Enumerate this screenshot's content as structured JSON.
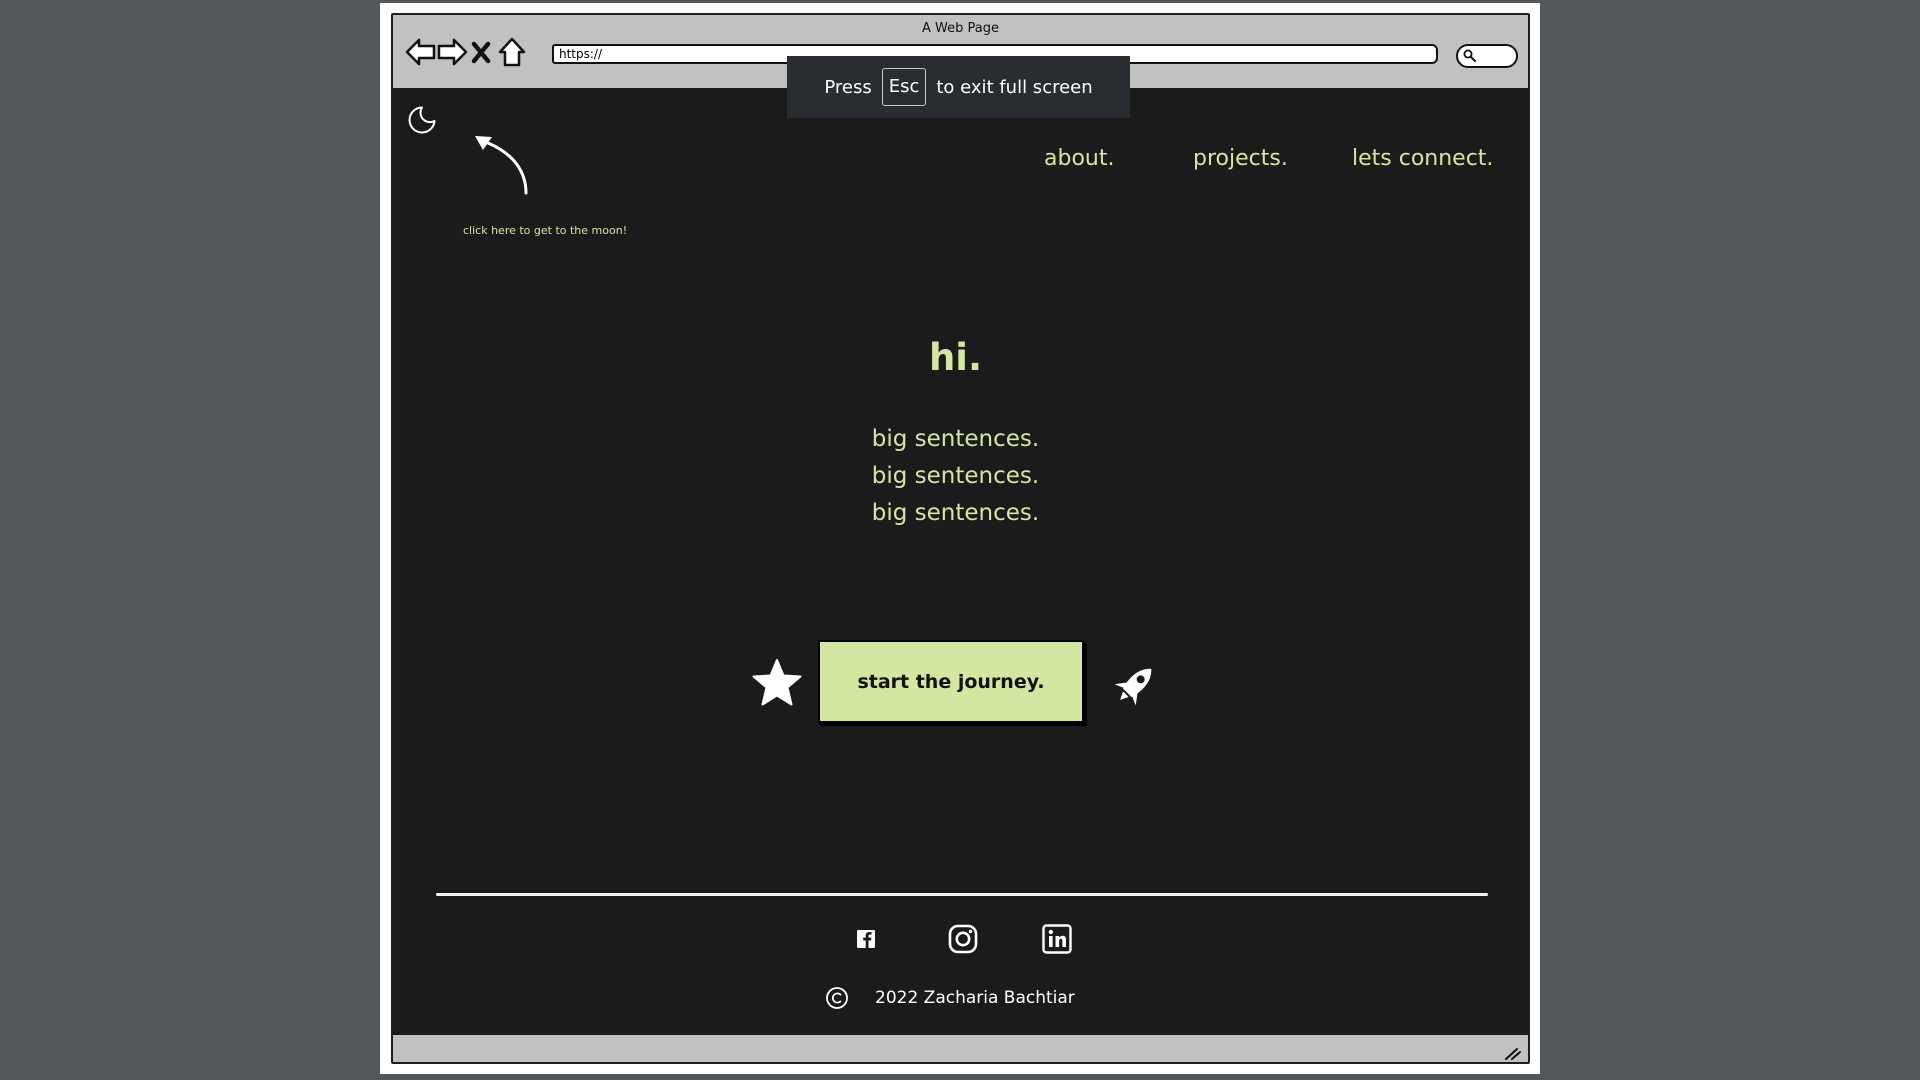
{
  "browser": {
    "window_title": "A Web Page",
    "url": "https://",
    "fullscreen_notice": {
      "before": "Press",
      "key": "Esc",
      "after": "to exit full screen"
    }
  },
  "page": {
    "theme_toggle_icon": "moon-icon",
    "hint": "click here to get to the moon!",
    "nav": [
      "about.",
      "projects.",
      "lets connect."
    ],
    "hero": {
      "title": "hi.",
      "lines": [
        "big sentences.",
        "big sentences.",
        "big sentences."
      ]
    },
    "cta": {
      "label": "start the journey.",
      "left_icon": "star-icon",
      "right_icon": "rocket-icon"
    },
    "footer": {
      "social_icons": [
        "facebook-icon",
        "instagram-icon",
        "linkedin-icon"
      ],
      "copyright_icon": "copyright-icon",
      "copyright_text": "2022 Zacharia Bachtiar"
    }
  },
  "colors": {
    "backdrop": "#53575b",
    "chrome": "#c1c1c1",
    "page_background": "#1b1b1b",
    "accent": "#d4e7a0",
    "text_light": "#ffffff"
  }
}
